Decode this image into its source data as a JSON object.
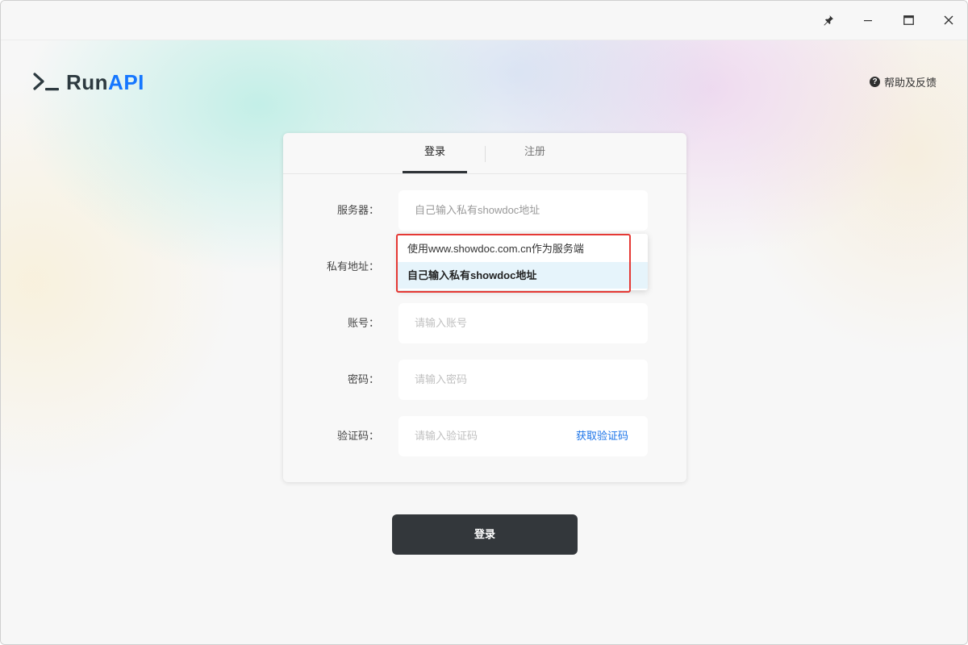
{
  "window": {
    "pin_icon": "pin-icon",
    "minimize_icon": "minimize-icon",
    "maximize_icon": "maximize-icon",
    "close_icon": "close-icon"
  },
  "brand": {
    "name_prefix": "Run",
    "name_suffix": "API",
    "accent_color": "#1677ff"
  },
  "help": {
    "icon": "question-circle-icon",
    "label": "帮助及反馈"
  },
  "tabs": {
    "login": "登录",
    "register": "注册",
    "active": "登录"
  },
  "form": {
    "server": {
      "label": "服务器：",
      "value": "自己输入私有showdoc地址"
    },
    "private_address": {
      "label": "私有地址："
    },
    "account": {
      "label": "账号：",
      "placeholder": "请输入账号"
    },
    "password": {
      "label": "密码：",
      "placeholder": "请输入密码"
    },
    "captcha": {
      "label": "验证码：",
      "placeholder": "请输入验证码",
      "get_code_label": "获取验证码"
    }
  },
  "server_dropdown": {
    "options": [
      "使用www.showdoc.com.cn作为服务端",
      "自己输入私有showdoc地址"
    ],
    "selected": "自己输入私有showdoc地址"
  },
  "actions": {
    "login_button": "登录",
    "button_color": "#33373b"
  },
  "annotation": {
    "highlight_color": "#e53935"
  }
}
